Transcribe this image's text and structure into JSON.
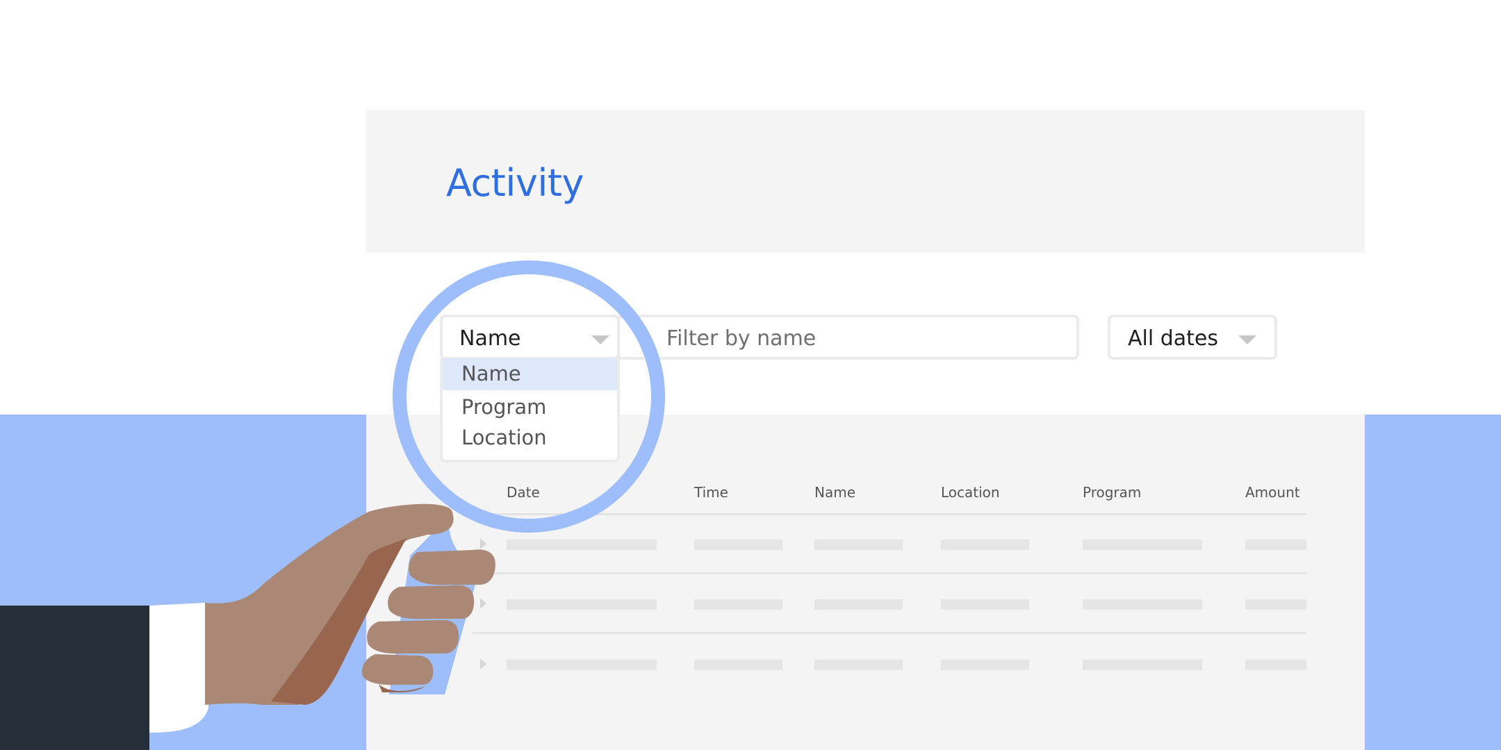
{
  "header": {
    "title": "Activity"
  },
  "filters": {
    "field_select": {
      "value": "Name",
      "icon": "chevron-down-icon"
    },
    "search": {
      "placeholder": "Filter by name"
    },
    "date_select": {
      "value": "All dates",
      "icon": "chevron-down-icon"
    }
  },
  "field_dropdown": {
    "options": [
      "Name",
      "Program",
      "Location"
    ],
    "selected": "Name"
  },
  "table": {
    "columns": [
      "Date",
      "Time",
      "Name",
      "Location",
      "Program",
      "Amount"
    ],
    "rows_shown": 3,
    "row_content": "placeholder"
  },
  "illustration": {
    "icon": "magnifying-glass-icon",
    "accent_color": "#9dbefa",
    "title_color": "#2f6ee0"
  }
}
